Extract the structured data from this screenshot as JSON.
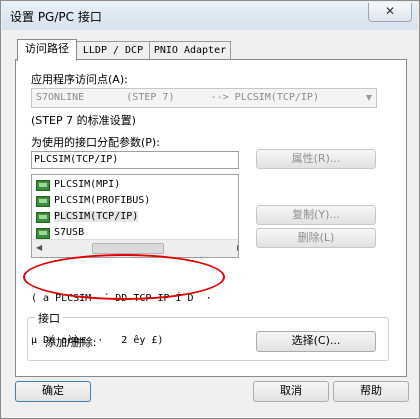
{
  "window": {
    "title": "设置 PG/PC 接口",
    "close_glyph": "✕"
  },
  "tabs": [
    {
      "label": "访问路径"
    },
    {
      "label": "LLDP / DCP"
    },
    {
      "label": "PNIO Adapter"
    }
  ],
  "access_path": {
    "app_access_point_label": "应用程序访问点(A):",
    "app_access_point_value": "S7ONLINE       (STEP 7)      --> PLCSIM(TCP/IP)",
    "default_setting_text": "(STEP 7 的标准设置)",
    "interface_param_label": "为使用的接口分配参数(P):",
    "interface_param_value": "PLCSIM(TCP/IP)",
    "interface_list": [
      {
        "label": "PLCSIM(MPI)"
      },
      {
        "label": "PLCSIM(PROFIBUS)"
      },
      {
        "label": "PLCSIM(TCP/IP)"
      },
      {
        "label": "S7USB"
      }
    ],
    "selected_index": 2,
    "properties_button": "属性(R)...",
    "copy_button": "复制(Y)...",
    "delete_button": "删除(L)",
    "description_line1": "( a PLCSIM  ´ DD TCP-IP Í¨D  ·",
    "description_line2": "µ Dé aèè±  ·   2 êy £)",
    "interfaces_group_title": "接口",
    "add_remove_label": "添加/删除:",
    "select_button": "选择(C)..."
  },
  "footer": {
    "ok_button": "确定",
    "cancel_button": "取消",
    "help_button": "帮助"
  },
  "icons": {
    "close": "close-icon",
    "dropdown": "chevron-down-icon",
    "interface": "network-card-icon"
  },
  "colors": {
    "annotation": "#e00000",
    "interface_icon": "#3c8c3c"
  }
}
